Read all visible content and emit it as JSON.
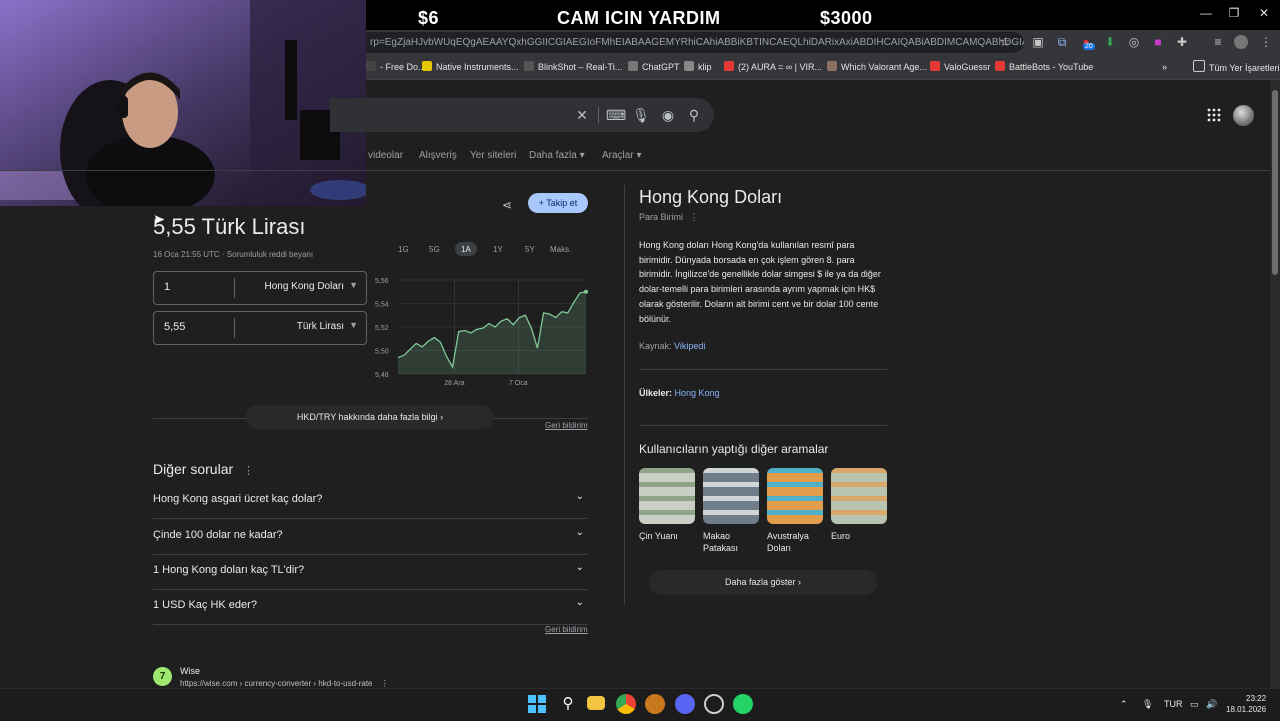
{
  "overlay": {
    "left_text": "$6",
    "center_text": "CAM ICIN YARDIM",
    "right_text": "$3000"
  },
  "browser": {
    "url": "rp=EgZjaHJvbWUqEQgAEAAYQxhGGIICGIAEGIoFMhEIABAAGEMYRhiCAhiABBiKBTINCAEQLhiDARixAxiABDIHCAIQABiABDIMCAMQABhDGIAEGIoFMgc...",
    "bookmarks": [
      {
        "label": "- Free Do...",
        "color": "#444"
      },
      {
        "label": "Native Instruments...",
        "color": "#e6c600"
      },
      {
        "label": "BlinkShot – Real-Ti...",
        "color": "#555"
      },
      {
        "label": "ChatGPT",
        "color": "#777"
      },
      {
        "label": "klip",
        "color": "#888"
      },
      {
        "label": "(2) AURA = ∞ | VIR...",
        "color": "#e53935"
      },
      {
        "label": "Which Valorant Age...",
        "color": "#8d6e63"
      },
      {
        "label": "ValoGuessr",
        "color": "#e53935"
      },
      {
        "label": "BattleBots - YouTube",
        "color": "#e53935"
      }
    ],
    "all_bookmarks": "Tüm Yer İşaretleri",
    "badge": "20"
  },
  "google": {
    "tabs": [
      "videolar",
      "Alışveriş",
      "Yer siteleri",
      "Daha fazla",
      "Araçlar"
    ]
  },
  "converter": {
    "result": "5,55 Türk Lirası",
    "timestamp": "16 Oca 21:55 UTC · Sorumluluk reddi beyanı",
    "from_value": "1",
    "from_currency": "Hong Kong Doları",
    "to_value": "5,55",
    "to_currency": "Türk Lirası",
    "follow": "Takip et",
    "ranges": [
      "1G",
      "5G",
      "1A",
      "1Y",
      "5Y",
      "Maks."
    ],
    "active_range": "1A",
    "more_info": "HKD/TRY hakkında daha fazla bilgi",
    "feedback": "Geri bildirim"
  },
  "chart_data": {
    "type": "area",
    "title": "",
    "xlabel": "",
    "ylabel": "",
    "ylim": [
      5.48,
      5.56
    ],
    "yticks": [
      "5,56",
      "5,54",
      "5,52",
      "5,50",
      "5,48"
    ],
    "xticks": [
      "28 Ara",
      "7 Oca"
    ],
    "color": "#81c995",
    "series": [
      {
        "values": [
          5.494,
          5.496,
          5.501,
          5.506,
          5.503,
          5.508,
          5.511,
          5.507,
          5.495,
          5.486,
          5.516,
          5.517,
          5.515,
          5.518,
          5.519,
          5.523,
          5.52,
          5.525,
          5.527,
          5.522,
          5.528,
          5.53,
          5.519,
          5.502,
          5.532,
          5.531,
          5.528,
          5.533,
          5.532,
          5.541,
          5.549,
          5.55
        ]
      }
    ]
  },
  "questions": {
    "title": "Diğer sorular",
    "items": [
      "Hong Kong asgari ücret kaç dolar?",
      "Çinde 100 dolar ne kadar?",
      "1 Hong Kong doları kaç TL'dir?",
      "1 USD Kaç HK eder?"
    ],
    "feedback": "Geri bildirim"
  },
  "result": {
    "name": "Wise",
    "url": "https://wise.com › currency-converter › hkd-to-usd-rate"
  },
  "knowledge": {
    "title": "Hong Kong Doları",
    "subtitle": "Para Birimi",
    "description": "Hong Kong doları Hong Kong'da kullanılan resmî para birimidir. Dünyada borsada en çok işlem gören 8. para birimidir. İngilizce'de genellikle dolar simgesi $ ile ya da diğer dolar-temelli para birimleri arasında ayrım yapmak için HK$ olarak gösterilir. Doların alt birimi cent ve bir dolar 100 cente bölünür.",
    "source_label": "Kaynak: ",
    "source_link": "Vikipedi",
    "countries_label": "Ülkeler: ",
    "countries_value": "Hong Kong",
    "also_title": "Kullanıcıların yaptığı diğer aramalar",
    "also": [
      {
        "label": "Çin Yuanı",
        "c1": "#c9cfc4",
        "c2": "#8fa58a"
      },
      {
        "label": "Makao Patakası",
        "c1": "#6f7d8a",
        "c2": "#cfd4d6"
      },
      {
        "label": "Avustralya Doları",
        "c1": "#e29d4b",
        "c2": "#4fb0c8"
      },
      {
        "label": "Euro",
        "c1": "#b9c4b0",
        "c2": "#d8a86a"
      }
    ],
    "more": "Daha fazla göster"
  },
  "taskbar": {
    "lang": "TUR",
    "time": "23:22",
    "date": "18.01.2026"
  }
}
